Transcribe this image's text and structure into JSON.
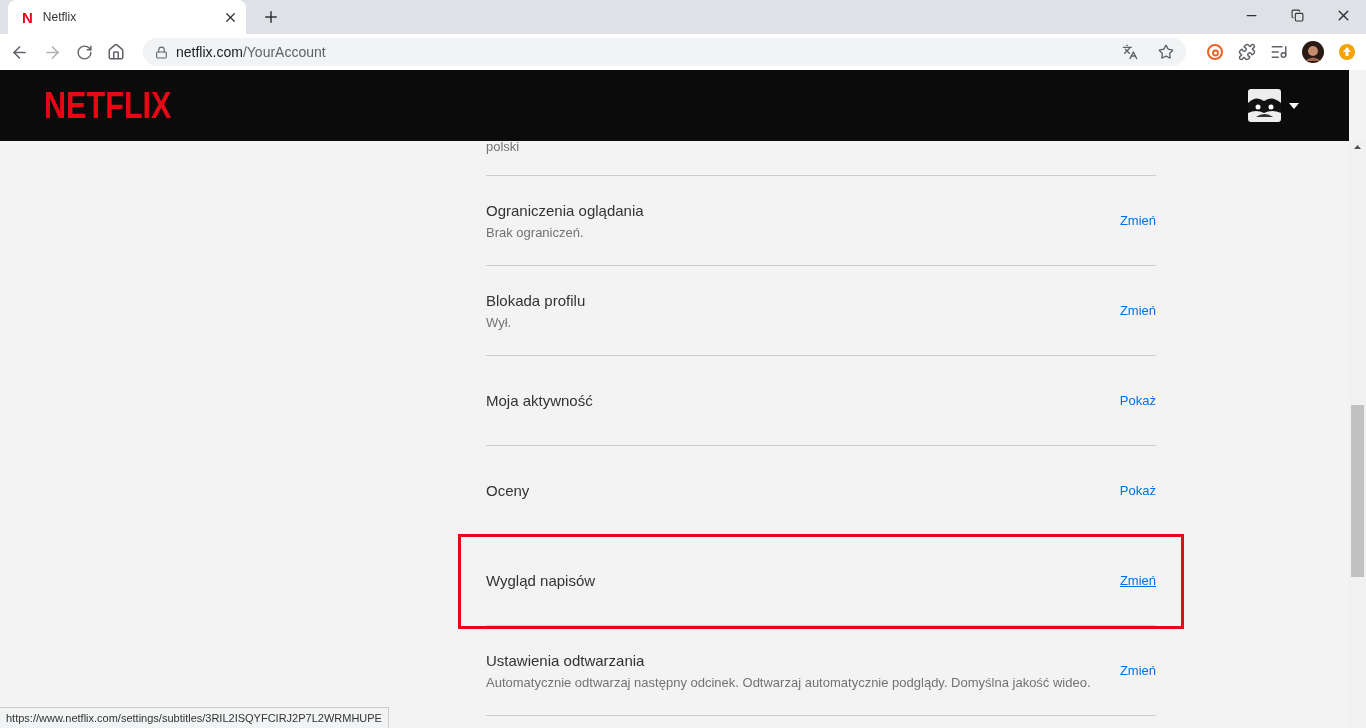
{
  "browser": {
    "tab": {
      "favicon": "N",
      "title": "Netflix",
      "selected": true
    },
    "address": {
      "host": "netflix.com",
      "path": "/YourAccount"
    }
  },
  "header": {
    "logo": "NETFLIX"
  },
  "settings": [
    {
      "kind": "partial",
      "subtitle": "polski"
    },
    {
      "kind": "row",
      "title": "Ograniczenia oglądania",
      "subtitle": "Brak ograniczeń.",
      "action": "Zmień",
      "highlighted": false
    },
    {
      "kind": "row",
      "title": "Blokada profilu",
      "subtitle": "Wył.",
      "action": "Zmień",
      "highlighted": false
    },
    {
      "kind": "row",
      "title": "Moja aktywność",
      "action": "Pokaż",
      "highlighted": false
    },
    {
      "kind": "row",
      "title": "Oceny",
      "action": "Pokaż",
      "highlighted": false
    },
    {
      "kind": "row",
      "title": "Wygląd napisów",
      "action": "Zmień",
      "highlighted": true
    },
    {
      "kind": "row",
      "title": "Ustawienia odtwarzania",
      "subtitle": "Automatycznie odtwarzaj następny odcinek. Odtwarzaj automatycznie podglądy. Domyślna jakość wideo.",
      "action": "Zmień",
      "highlighted": false
    }
  ],
  "status_bar": {
    "url": "https://www.netflix.com/settings/subtitles/3RIL2ISQYFCIRJ2P7L2WRMHUPE"
  }
}
